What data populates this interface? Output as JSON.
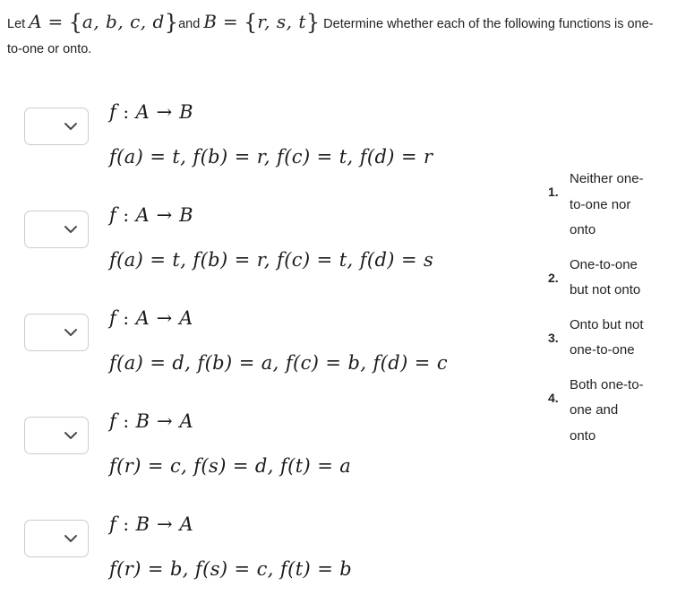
{
  "prompt": {
    "lead": "Let ",
    "set_a_name": "A",
    "equals": " = ",
    "set_a_open": "{",
    "set_a_elements": "a,  b,  c,  d",
    "set_a_close": "}",
    "conjunction": "and ",
    "set_b_name": "B",
    "set_b_open": "{",
    "set_b_elements": "r,  s,  t",
    "set_b_close": "}",
    "instruction": " Determine whether each of the following functions is one-to-one or onto."
  },
  "dropdown": {
    "icon": "chevron-down-icon",
    "value": "",
    "placeholder": ""
  },
  "questions": [
    {
      "signature_fn": "f",
      "signature_colon": " : ",
      "signature_domain": "A",
      "signature_arrow": " → ",
      "signature_codomain": "B",
      "values": "f(a) = t,  f(b) = r,  f(c) = t,  f(d) = r"
    },
    {
      "signature_fn": "f",
      "signature_colon": " : ",
      "signature_domain": "A",
      "signature_arrow": " → ",
      "signature_codomain": "B",
      "values": "f(a) = t,  f(b) = r,  f(c) = t,  f(d) = s"
    },
    {
      "signature_fn": "f",
      "signature_colon": " : ",
      "signature_domain": "A",
      "signature_arrow": " → ",
      "signature_codomain": "A",
      "values": "f(a) = d,  f(b) = a,  f(c) = b,  f(d) = c"
    },
    {
      "signature_fn": "f",
      "signature_colon": " : ",
      "signature_domain": "B",
      "signature_arrow": " → ",
      "signature_codomain": "A",
      "values": "f(r) = c,  f(s) = d,  f(t) = a"
    },
    {
      "signature_fn": "f",
      "signature_colon": " : ",
      "signature_domain": "B",
      "signature_arrow": " → ",
      "signature_codomain": "A",
      "values": "f(r) = b,  f(s) = c,  f(t) = b"
    }
  ],
  "options": [
    {
      "number": "1.",
      "label": "Neither one-to-one nor onto"
    },
    {
      "number": "2.",
      "label": "One-to-one but not onto"
    },
    {
      "number": "3.",
      "label": "Onto but not one-to-one"
    },
    {
      "number": "4.",
      "label": "Both one-to-one and onto"
    }
  ],
  "colors": {
    "text": "#232323",
    "border": "#cccccc",
    "background": "#ffffff"
  }
}
